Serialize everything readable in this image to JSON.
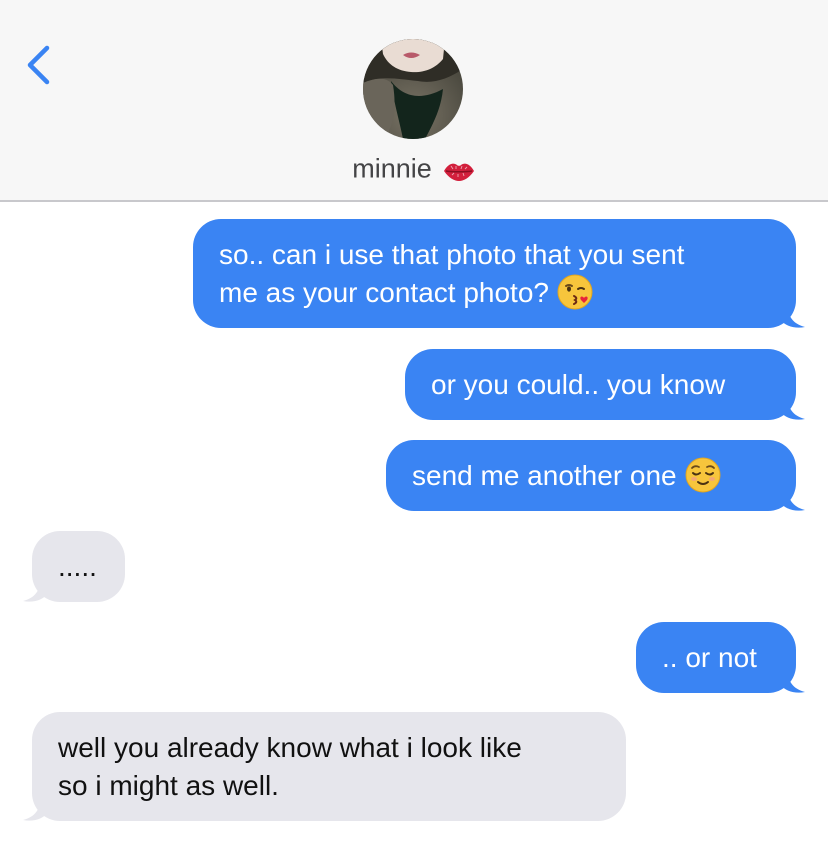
{
  "header": {
    "contact_name": "minnie",
    "contact_emoji": "kiss-mark",
    "back_icon": "chevron-left-icon"
  },
  "messages": [
    {
      "direction": "sent",
      "lines": [
        "so.. can i use that photo that you sent",
        "me as your contact photo?"
      ],
      "emoji": "face-blowing-kiss"
    },
    {
      "direction": "sent",
      "lines": [
        "or you could.. you know"
      ]
    },
    {
      "direction": "sent",
      "lines": [
        "send me another one"
      ],
      "emoji": "relieved-face"
    },
    {
      "direction": "received",
      "lines": [
        "....."
      ]
    },
    {
      "direction": "sent",
      "lines": [
        ".. or not"
      ]
    },
    {
      "direction": "received",
      "lines": [
        "well you already know what i look like",
        "so i might as well."
      ]
    }
  ],
  "colors": {
    "sent_bubble": "#3a84f3",
    "received_bubble": "#e6e6ec",
    "header_bg": "#f7f7f7",
    "accent": "#3a84f3"
  }
}
